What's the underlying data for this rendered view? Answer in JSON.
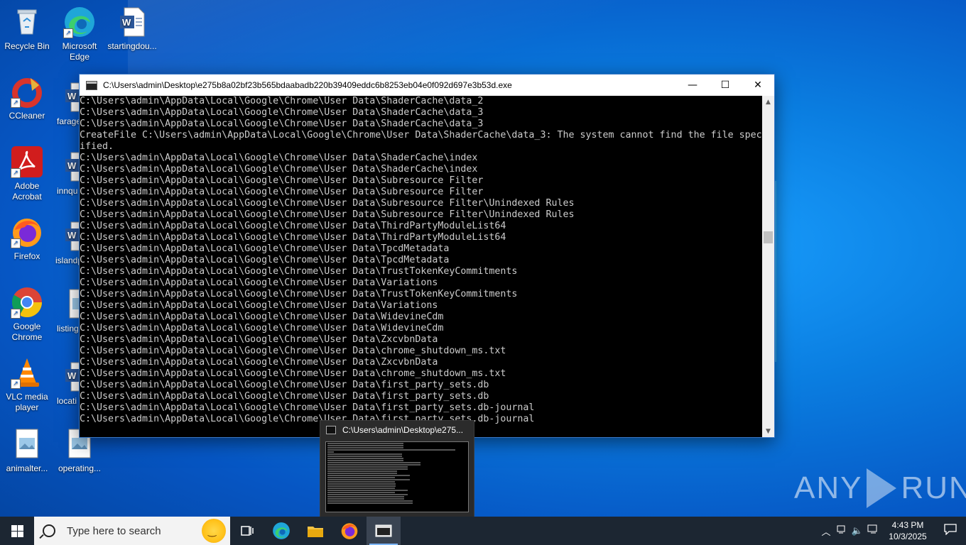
{
  "desktop": {
    "icons": [
      {
        "label": "Recycle Bin"
      },
      {
        "label": "Microsoft Edge"
      },
      {
        "label": "startingdou..."
      },
      {
        "label": "CCleaner"
      },
      {
        "label": "farage"
      },
      {
        "label": "Adobe Acrobat"
      },
      {
        "label": "innqu"
      },
      {
        "label": "Firefox"
      },
      {
        "label": "islandp"
      },
      {
        "label": "Google Chrome"
      },
      {
        "label": "listing"
      },
      {
        "label": "VLC media player"
      },
      {
        "label": "locati"
      },
      {
        "label": "animalter..."
      },
      {
        "label": "operating..."
      }
    ]
  },
  "window": {
    "title": "C:\\Users\\admin\\Desktop\\e275b8a02bf23b565bdaabadb220b39409eddc6b8253eb04e0f092d697e3b53d.exe",
    "minimize": "—",
    "maximize": "☐",
    "close": "✕",
    "lines": [
      "C:\\Users\\admin\\AppData\\Local\\Google\\Chrome\\User Data\\ShaderCache\\data_2",
      "C:\\Users\\admin\\AppData\\Local\\Google\\Chrome\\User Data\\ShaderCache\\data_3",
      "C:\\Users\\admin\\AppData\\Local\\Google\\Chrome\\User Data\\ShaderCache\\data_3",
      "CreateFile C:\\Users\\admin\\AppData\\Local\\Google\\Chrome\\User Data\\ShaderCache\\data_3: The system cannot find the file spec",
      "ified.",
      "C:\\Users\\admin\\AppData\\Local\\Google\\Chrome\\User Data\\ShaderCache\\index",
      "C:\\Users\\admin\\AppData\\Local\\Google\\Chrome\\User Data\\ShaderCache\\index",
      "C:\\Users\\admin\\AppData\\Local\\Google\\Chrome\\User Data\\Subresource Filter",
      "C:\\Users\\admin\\AppData\\Local\\Google\\Chrome\\User Data\\Subresource Filter",
      "C:\\Users\\admin\\AppData\\Local\\Google\\Chrome\\User Data\\Subresource Filter\\Unindexed Rules",
      "C:\\Users\\admin\\AppData\\Local\\Google\\Chrome\\User Data\\Subresource Filter\\Unindexed Rules",
      "C:\\Users\\admin\\AppData\\Local\\Google\\Chrome\\User Data\\ThirdPartyModuleList64",
      "C:\\Users\\admin\\AppData\\Local\\Google\\Chrome\\User Data\\ThirdPartyModuleList64",
      "C:\\Users\\admin\\AppData\\Local\\Google\\Chrome\\User Data\\TpcdMetadata",
      "C:\\Users\\admin\\AppData\\Local\\Google\\Chrome\\User Data\\TpcdMetadata",
      "C:\\Users\\admin\\AppData\\Local\\Google\\Chrome\\User Data\\TrustTokenKeyCommitments",
      "C:\\Users\\admin\\AppData\\Local\\Google\\Chrome\\User Data\\Variations",
      "C:\\Users\\admin\\AppData\\Local\\Google\\Chrome\\User Data\\TrustTokenKeyCommitments",
      "C:\\Users\\admin\\AppData\\Local\\Google\\Chrome\\User Data\\Variations",
      "C:\\Users\\admin\\AppData\\Local\\Google\\Chrome\\User Data\\WidevineCdm",
      "C:\\Users\\admin\\AppData\\Local\\Google\\Chrome\\User Data\\WidevineCdm",
      "C:\\Users\\admin\\AppData\\Local\\Google\\Chrome\\User Data\\ZxcvbnData",
      "C:\\Users\\admin\\AppData\\Local\\Google\\Chrome\\User Data\\chrome_shutdown_ms.txt",
      "C:\\Users\\admin\\AppData\\Local\\Google\\Chrome\\User Data\\ZxcvbnData",
      "C:\\Users\\admin\\AppData\\Local\\Google\\Chrome\\User Data\\chrome_shutdown_ms.txt",
      "C:\\Users\\admin\\AppData\\Local\\Google\\Chrome\\User Data\\first_party_sets.db",
      "C:\\Users\\admin\\AppData\\Local\\Google\\Chrome\\User Data\\first_party_sets.db",
      "C:\\Users\\admin\\AppData\\Local\\Google\\Chrome\\User Data\\first_party_sets.db-journal",
      "C:\\Users\\admin\\AppData\\Local\\Google\\Chrome\\User Data\\first_party_sets.db-journal"
    ]
  },
  "preview": {
    "title": "C:\\Users\\admin\\Desktop\\e275..."
  },
  "taskbar": {
    "search_placeholder": "Type here to search",
    "time": "4:43 PM",
    "date": "10/3/2025"
  },
  "watermark": {
    "left": "ANY",
    "right": "RUN"
  }
}
